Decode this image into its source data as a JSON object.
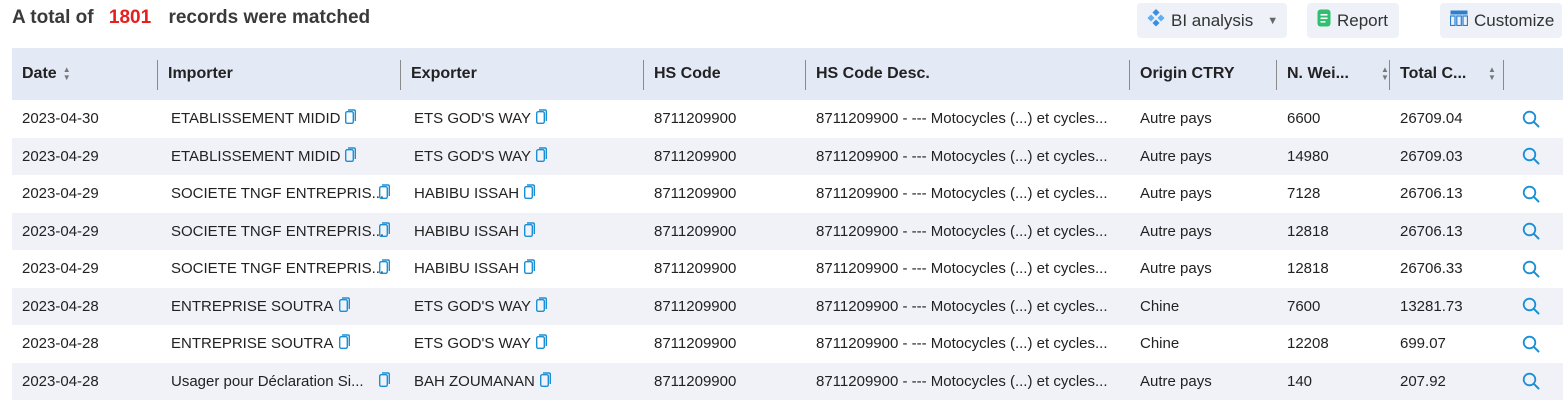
{
  "summary": {
    "prefix": "A total of",
    "count": "1801",
    "suffix": "records were matched"
  },
  "toolbar": {
    "bi_label": "BI analysis",
    "bi_icon": "bi-diamond-icon",
    "report_label": "Report",
    "report_icon": "report-doc-icon",
    "customize_label": "Customize",
    "customize_icon": "columns-grid-icon"
  },
  "colors": {
    "accent": "#1a8fd6",
    "count": "#e61e1e",
    "header_bg": "#e4e9f6",
    "row_alt": "#f0f2f8",
    "button_bg": "#eef1f8"
  },
  "table": {
    "headers": [
      "Date",
      "Importer",
      "Exporter",
      "HS Code",
      "HS Code Desc.",
      "Origin CTRY",
      "N. Wei...",
      "Total C..."
    ],
    "rows": [
      [
        "2023-04-30",
        "ETABLISSEMENT MIDID",
        "ETS GOD'S WAY",
        "8711209900",
        "8711209900 - --- Motocycles (...) et cycles...",
        "Autre pays",
        "6600",
        "26709.04"
      ],
      [
        "2023-04-29",
        "ETABLISSEMENT MIDID",
        "ETS GOD'S WAY",
        "8711209900",
        "8711209900 - --- Motocycles (...) et cycles...",
        "Autre pays",
        "14980",
        "26709.03"
      ],
      [
        "2023-04-29",
        "SOCIETE TNGF ENTREPRIS...",
        "HABIBU ISSAH",
        "8711209900",
        "8711209900 - --- Motocycles (...) et cycles...",
        "Autre pays",
        "7128",
        "26706.13"
      ],
      [
        "2023-04-29",
        "SOCIETE TNGF ENTREPRIS...",
        "HABIBU ISSAH",
        "8711209900",
        "8711209900 - --- Motocycles (...) et cycles...",
        "Autre pays",
        "12818",
        "26706.13"
      ],
      [
        "2023-04-29",
        "SOCIETE TNGF ENTREPRIS...",
        "HABIBU ISSAH",
        "8711209900",
        "8711209900 - --- Motocycles (...) et cycles...",
        "Autre pays",
        "12818",
        "26706.33"
      ],
      [
        "2023-04-28",
        "ENTREPRISE SOUTRA",
        "ETS GOD'S WAY",
        "8711209900",
        "8711209900 - --- Motocycles (...) et cycles...",
        "Chine",
        "7600",
        "13281.73"
      ],
      [
        "2023-04-28",
        "ENTREPRISE SOUTRA",
        "ETS GOD'S WAY",
        "8711209900",
        "8711209900 - --- Motocycles (...) et cycles...",
        "Chine",
        "12208",
        "699.07"
      ],
      [
        "2023-04-28",
        "Usager pour Déclaration Si...",
        "BAH ZOUMANAN",
        "8711209900",
        "8711209900 - --- Motocycles (...) et cycles...",
        "Autre pays",
        "140",
        "207.92"
      ]
    ]
  }
}
